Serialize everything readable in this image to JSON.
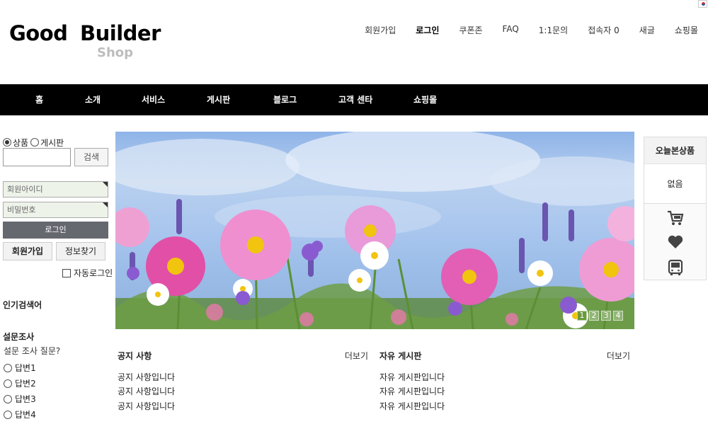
{
  "header": {
    "logo_main": "Good  Builder",
    "logo_sub": "Shop",
    "top_links": [
      {
        "label": "회원가입",
        "bold": false
      },
      {
        "label": "로그인",
        "bold": true
      },
      {
        "label": "쿠폰존",
        "bold": false
      },
      {
        "label": "FAQ",
        "bold": false
      },
      {
        "label": "1:1문의",
        "bold": false
      },
      {
        "label": "접속자 0",
        "bold": false
      },
      {
        "label": "새글",
        "bold": false
      },
      {
        "label": "쇼핑몰",
        "bold": false
      }
    ]
  },
  "nav": {
    "items": [
      "홈",
      "소개",
      "서비스",
      "게시판",
      "블로그",
      "고객 센타",
      "쇼핑몰"
    ]
  },
  "sidebar": {
    "search_scope": {
      "product": "상품",
      "board": "게시판",
      "selected": "상품"
    },
    "search_button": "검색",
    "login": {
      "id_placeholder": "회원아이디",
      "pw_placeholder": "비밀번호",
      "login_button": "로그인",
      "join_button": "회원가입",
      "find_button": "정보찾기",
      "auto_login": "자동로그인"
    },
    "popular_title": "인기검색어",
    "poll": {
      "title": "설문조사",
      "question": "설문 조사 질문?",
      "options": [
        "답변1",
        "답변2",
        "답변3",
        "답변4"
      ]
    }
  },
  "banner": {
    "pages": [
      "1",
      "2",
      "3",
      "4"
    ],
    "active_page": "1"
  },
  "boards": [
    {
      "title": "공지 사항",
      "more": "더보기",
      "items": [
        "공지 사항입니다",
        "공지 사항입니다",
        "공지 사항입니다"
      ]
    },
    {
      "title": "자유 게시판",
      "more": "더보기",
      "items": [
        "자유 게시판입니다",
        "자유 게시판입니다",
        "자유 게시판입니다"
      ]
    }
  ],
  "today_viewed": {
    "title": "오늘본상품",
    "empty": "없음",
    "icons": [
      "cart-icon",
      "heart-icon",
      "bus-icon"
    ]
  },
  "colors": {
    "nav_bg": "#000000",
    "login_button_bg": "#666870",
    "logo_sub": "#bdbdbd"
  }
}
